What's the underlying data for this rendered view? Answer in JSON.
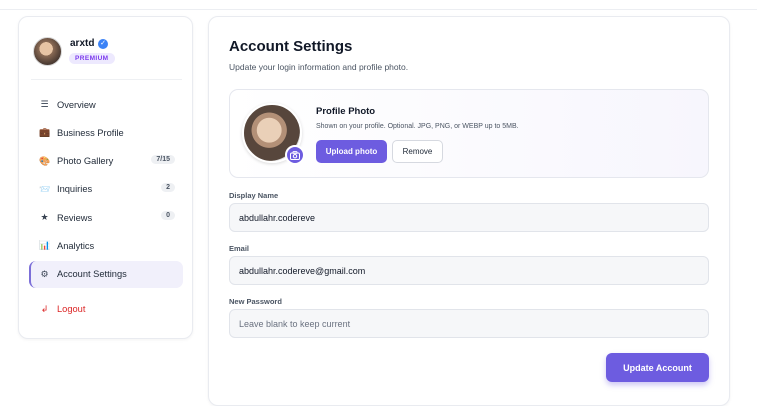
{
  "colors": {
    "accent": "#6d5ce0",
    "danger": "#dc2626",
    "badge_bg": "#ede9fe",
    "verified": "#3b82f6"
  },
  "user": {
    "name": "arxtd",
    "badge": "PREMIUM",
    "verified_icon": "check-icon"
  },
  "nav": {
    "items": [
      {
        "icon": "list-icon",
        "glyph": "☰",
        "label": "Overview",
        "count": null
      },
      {
        "icon": "briefcase-icon",
        "glyph": "💼",
        "label": "Business Profile",
        "count": null
      },
      {
        "icon": "gallery-icon",
        "glyph": "🎨",
        "label": "Photo Gallery",
        "count": "7/15"
      },
      {
        "icon": "inbox-icon",
        "glyph": "📨",
        "label": "Inquiries",
        "count": "2"
      },
      {
        "icon": "star-icon",
        "glyph": "★",
        "label": "Reviews",
        "count": "0"
      },
      {
        "icon": "chart-icon",
        "glyph": "📊",
        "label": "Analytics",
        "count": null
      },
      {
        "icon": "gear-icon",
        "glyph": "⚙",
        "label": "Account Settings",
        "count": null,
        "active": true
      }
    ],
    "logout": {
      "icon": "logout-icon",
      "glyph": "↲",
      "label": "Logout"
    }
  },
  "main": {
    "title": "Account Settings",
    "subtitle": "Update your login information and profile photo.",
    "photo": {
      "heading": "Profile Photo",
      "hint": "Shown on your profile. Optional. JPG, PNG, or WEBP up to 5MB.",
      "upload_label": "Upload photo",
      "remove_label": "Remove"
    },
    "fields": {
      "display_name": {
        "label": "Display Name",
        "value": "abdullahr.codereve",
        "placeholder": ""
      },
      "email": {
        "label": "Email",
        "value": "abdullahr.codereve@gmail.com",
        "placeholder": ""
      },
      "password": {
        "label": "New Password",
        "value": "",
        "placeholder": "Leave blank to keep current"
      }
    },
    "submit_label": "Update Account"
  }
}
